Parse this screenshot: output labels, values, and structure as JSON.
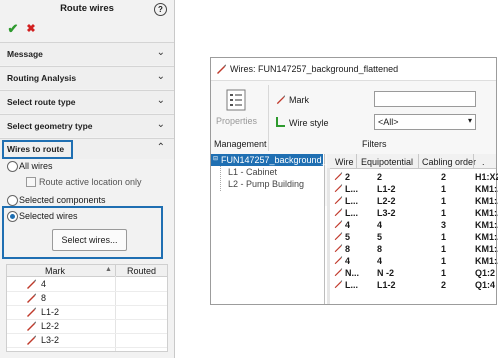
{
  "left_panel": {
    "title": "Route wires",
    "help_glyph": "?",
    "ok_glyph": "✔",
    "cancel_glyph": "✖",
    "sections": [
      {
        "label": "Message",
        "chevron": "⌄"
      },
      {
        "label": "Routing Analysis",
        "chevron": "⌄"
      },
      {
        "label": "Select route type",
        "chevron": "⌄"
      },
      {
        "label": "Select geometry type",
        "chevron": "⌄"
      }
    ],
    "wires_to_route": {
      "label": "Wires to route",
      "chevron": "⌃",
      "options": {
        "all_wires": "All wires",
        "route_active_location_only": "Route active location only",
        "selected_components": "Selected components",
        "selected_wires": "Selected wires"
      },
      "select_button": "Select wires..."
    },
    "grid": {
      "columns": [
        "Mark",
        "Routed"
      ],
      "sort_glyph": "▲",
      "rows": [
        {
          "mark": "4"
        },
        {
          "mark": "8"
        },
        {
          "mark": "L1-2"
        },
        {
          "mark": "L2-2"
        },
        {
          "mark": "L3-2"
        }
      ]
    }
  },
  "dialog": {
    "title": "Wires: FUN147257_background_flattened",
    "ribbon": {
      "properties_label": "Properties",
      "management_label": "Management",
      "mark_label": "Mark",
      "wire_style_label": "Wire style",
      "wire_style_value": "<All>",
      "filters_label": "Filters",
      "mark_value": ""
    },
    "tree": {
      "root": "FUN147257_background_",
      "children": [
        "L1 - Cabinet",
        "L2 - Pump Building"
      ]
    },
    "table": {
      "columns": [
        "Wire",
        "Equipotential",
        "Cabling order",
        "."
      ],
      "rows": [
        {
          "wire": "2",
          "equipotential": "2",
          "order": "2",
          "conn": "H1:X2"
        },
        {
          "wire": "L...",
          "equipotential": "L1-2",
          "order": "1",
          "conn": "KM1:..."
        },
        {
          "wire": "L...",
          "equipotential": "L2-2",
          "order": "1",
          "conn": "KM1:..."
        },
        {
          "wire": "L...",
          "equipotential": "L3-2",
          "order": "1",
          "conn": "KM1:..."
        },
        {
          "wire": "4",
          "equipotential": "4",
          "order": "3",
          "conn": "KM1:..."
        },
        {
          "wire": "5",
          "equipotential": "5",
          "order": "1",
          "conn": "KM1:..."
        },
        {
          "wire": "8",
          "equipotential": "8",
          "order": "1",
          "conn": "KM1:..."
        },
        {
          "wire": "4",
          "equipotential": "4",
          "order": "1",
          "conn": "KM1:..."
        },
        {
          "wire": "N...",
          "equipotential": "N -2",
          "order": "1",
          "conn": "Q1:2"
        },
        {
          "wire": "L...",
          "equipotential": "L1-2",
          "order": "2",
          "conn": "Q1:4"
        }
      ]
    }
  },
  "colors": {
    "accent_blue": "#1f6fb2",
    "ok_green": "#2e9a2e",
    "cancel_red": "#d22020",
    "pen_red": "#c0392b"
  }
}
